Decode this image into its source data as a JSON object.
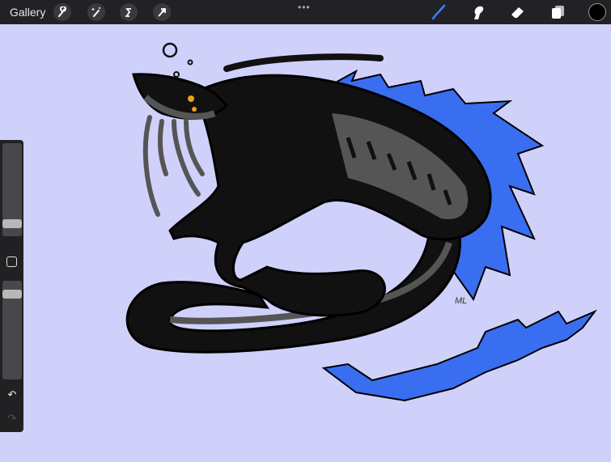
{
  "topbar": {
    "gallery_label": "Gallery",
    "left_tools": [
      "wrench-icon",
      "magic-wand-icon",
      "selection-icon",
      "transform-arrow-icon"
    ],
    "more_label": "•••",
    "right_tools": [
      "brush-icon",
      "smudge-icon",
      "eraser-icon",
      "layers-icon"
    ],
    "active_tool": "brush",
    "accent_color": "#3b82f6",
    "current_color": "#000000"
  },
  "sidebar": {
    "brush_size": 0.1,
    "opacity": 0.9,
    "undo_icon": "↶",
    "redo_icon": "↷"
  },
  "canvas": {
    "background_color": "#d0d1fb"
  }
}
